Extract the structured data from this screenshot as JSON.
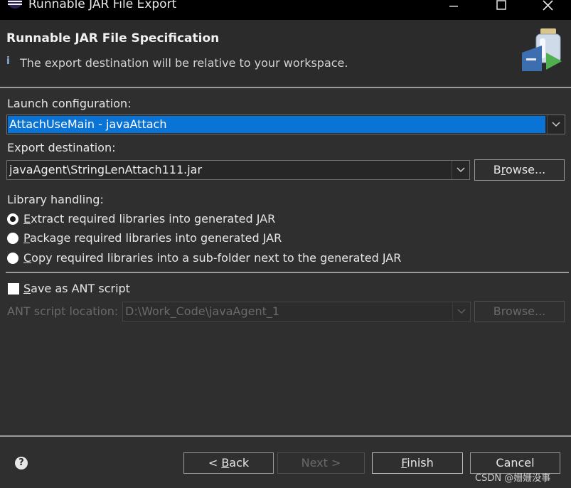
{
  "window": {
    "title": "Runnable JAR File Export"
  },
  "header": {
    "title": "Runnable JAR File Specification",
    "message": "The export destination will be relative to your workspace."
  },
  "launch": {
    "label": "Launch configuration:",
    "value": "AttachUseMain - javaAttach"
  },
  "export": {
    "label": "Export destination:",
    "value": "javaAgent\\StringLenAttach111.jar",
    "browse_first": "B",
    "browse_u": "r",
    "browse_rest": "owse..."
  },
  "library": {
    "label": "Library handling:",
    "options": [
      {
        "mnemonic": "E",
        "rest": "xtract required libraries into generated JAR",
        "checked": true
      },
      {
        "mnemonic": "P",
        "rest": "ackage required libraries into generated JAR",
        "checked": false
      },
      {
        "mnemonic": "C",
        "rest": "opy required libraries into a sub-folder next to the generated JAR",
        "checked": false
      }
    ]
  },
  "ant": {
    "save_mnemonic": "S",
    "save_rest": "ave as ANT script",
    "location_label": "ANT script location:",
    "location_value": "D:\\Work_Code\\javaAgent_1",
    "browse_label": "Browse..."
  },
  "footer": {
    "back_prefix": "< ",
    "back_mnemonic": "B",
    "back_rest": "ack",
    "next_label": "Next >",
    "finish_mnemonic": "F",
    "finish_rest": "inish",
    "cancel_label": "Cancel",
    "watermark": "CSDN @姗姗没事"
  },
  "colors": {
    "background": "#2f2f2f",
    "selection": "#0a73d6",
    "titlebar": "#000000"
  },
  "icons": [
    "eclipse-icon",
    "minimize-icon",
    "maximize-icon",
    "close-icon",
    "info-icon",
    "chevron-down-icon",
    "help-icon",
    "jar-wizard-icon"
  ]
}
